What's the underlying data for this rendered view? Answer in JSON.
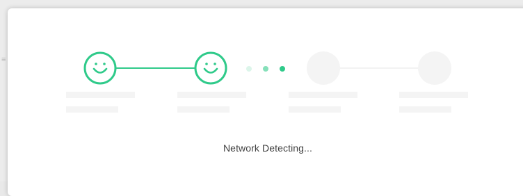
{
  "status": {
    "message": "Network Detecting..."
  },
  "steps": [
    {
      "state": "success",
      "icon": "smiley-icon"
    },
    {
      "state": "success",
      "icon": "smiley-icon"
    },
    {
      "state": "pending",
      "icon": "empty-circle"
    },
    {
      "state": "pending",
      "icon": "empty-circle"
    }
  ],
  "progress_dots": {
    "count": 3,
    "active_index": 2
  },
  "colors": {
    "accent": "#2fca8a",
    "dot_faint": "#dcf5ea",
    "dot_mid": "#86e0ba",
    "pending_circle": "#f4f4f4",
    "pending_line": "#f2f2f2",
    "skeleton": "#f4f4f4",
    "text": "#3f3f3f"
  }
}
